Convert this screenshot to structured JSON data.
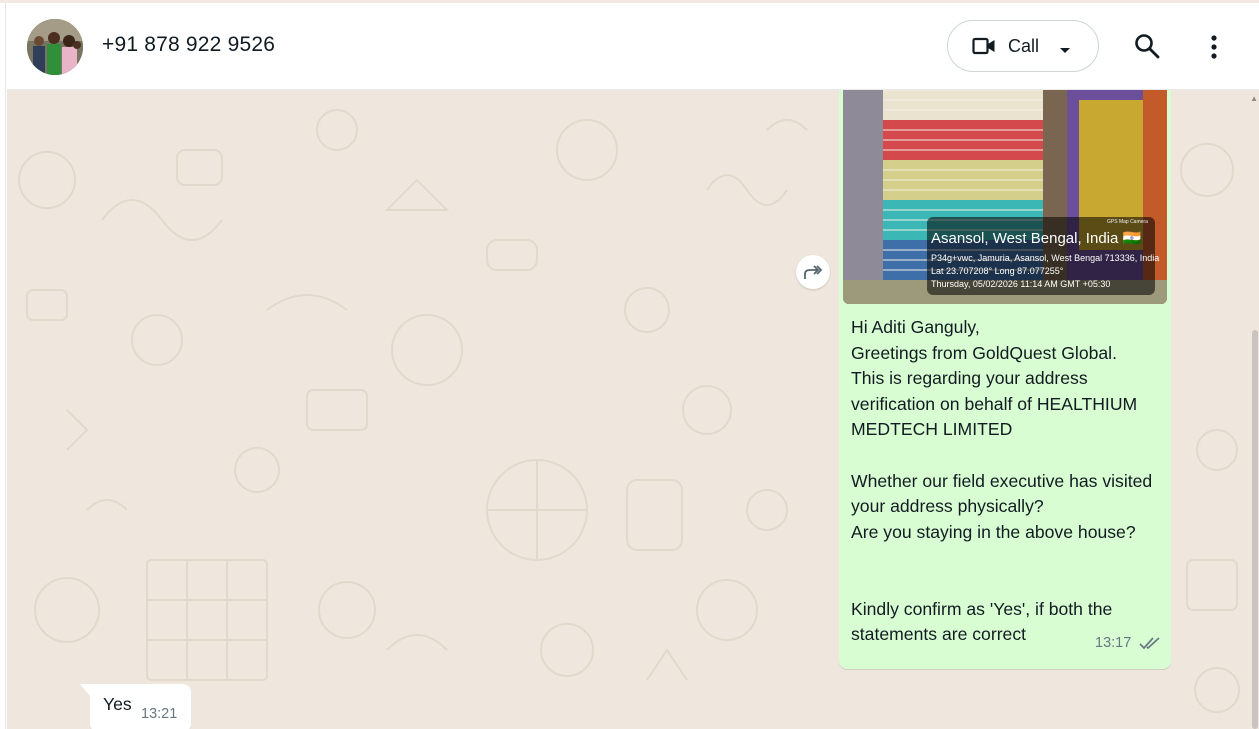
{
  "header": {
    "contact_name": "+91 878 922 9526",
    "call_label": "Call",
    "icons": [
      "avatar",
      "video-icon",
      "chevron-down-icon",
      "search-icon",
      "menu-icon"
    ]
  },
  "colors": {
    "chat_background": "#efe7de",
    "outgoing_bubble": "#d9fdd3",
    "incoming_bubble": "#ffffff",
    "timestamp": "#667781",
    "text": "#111b21"
  },
  "messages": {
    "outgoing": {
      "photo_caption": {
        "title": "Asansol, West Bengal, India 🇮🇳",
        "address": "P34g+vwc, Jamuria, Asansol, West Bengal 713336, India",
        "coords": "Lat 23.707208° Long 87.077255°",
        "datetime": "Thursday, 05/02/2026 11:14 AM GMT +05:30",
        "brand": "GPS Map Camera"
      },
      "text": "Hi Aditi Ganguly,\nGreetings from GoldQuest Global.\nThis is regarding your address verification on behalf of HEALTHIUM MEDTECH LIMITED\n\nWhether our field executive has visited your address physically?\nAre you staying in the above house?\n\n\nKindly confirm as 'Yes', if both the statements are correct",
      "time": "13:17",
      "status_icon": "double-check-icon"
    },
    "incoming": {
      "text": "Yes",
      "time": "13:21"
    }
  },
  "actions": {
    "forward_icon": "forward-icon"
  }
}
